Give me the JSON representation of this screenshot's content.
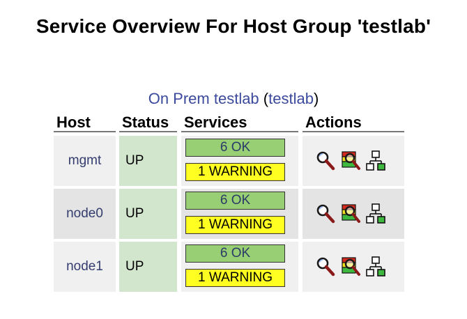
{
  "page": {
    "title": "Service Overview For Host Group 'testlab'"
  },
  "group": {
    "alias": "On Prem testlab",
    "open_paren": "(",
    "name": "testlab",
    "close_paren": ")"
  },
  "columns": {
    "host": "Host",
    "status": "Status",
    "services": "Services",
    "actions": "Actions"
  },
  "rows": [
    {
      "host": "mgmt",
      "status": "UP",
      "ok": "6 OK",
      "warning": "1 WARNING"
    },
    {
      "host": "node0",
      "status": "UP",
      "ok": "6 OK",
      "warning": "1 WARNING"
    },
    {
      "host": "node1",
      "status": "UP",
      "ok": "6 OK",
      "warning": "1 WARNING"
    }
  ],
  "actions": {
    "icons": [
      "host-details-icon",
      "service-details-icon",
      "network-map-icon"
    ]
  },
  "colors": {
    "status_up_bg": "#d2e6cd",
    "ok_badge": "#98cf74",
    "warning_badge": "#ffff22",
    "link": "#3b4a9c"
  }
}
